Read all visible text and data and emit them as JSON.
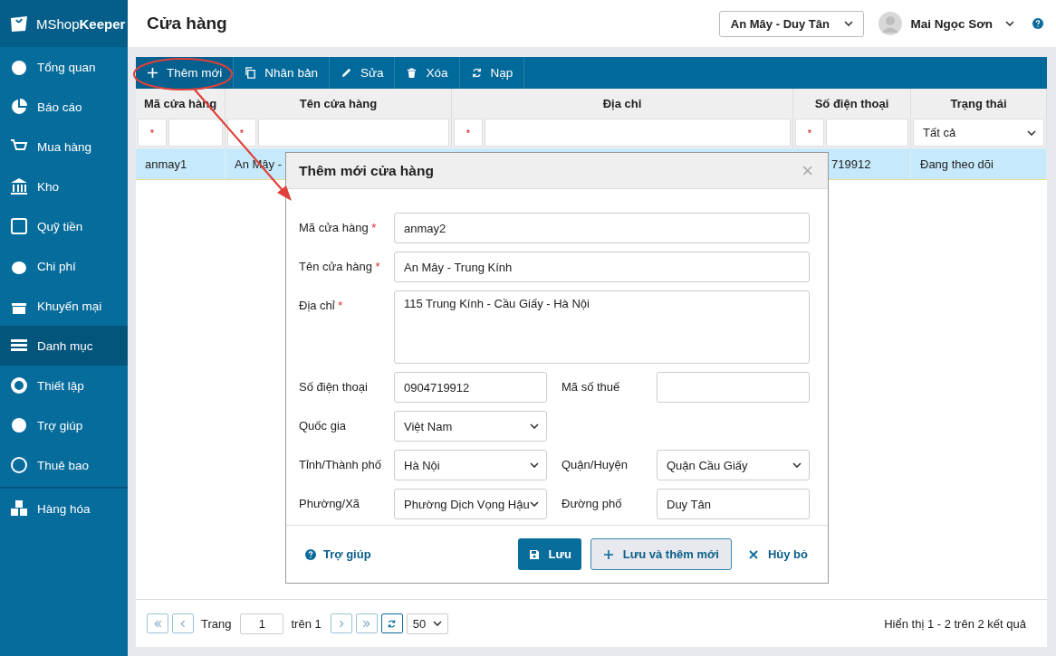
{
  "sidebar": {
    "logo": {
      "regular": "MShop",
      "bold": "Keeper"
    },
    "items": [
      {
        "label": "Tổng quan",
        "selected": false
      },
      {
        "label": "Báo cáo",
        "selected": false
      },
      {
        "label": "Mua hàng",
        "selected": false
      },
      {
        "label": "Kho",
        "selected": false
      },
      {
        "label": "Quỹ tiền",
        "selected": false
      },
      {
        "label": "Chi phí",
        "selected": false
      },
      {
        "label": "Khuyến mại",
        "selected": false
      },
      {
        "label": "Danh mục",
        "selected": true
      },
      {
        "label": "Thiết lập",
        "selected": false
      },
      {
        "label": "Trợ giúp",
        "selected": false
      },
      {
        "label": "Thuê bao",
        "selected": false
      }
    ],
    "bottom_item": {
      "label": "Hàng hóa",
      "selected": false
    }
  },
  "header": {
    "title": "Cửa hàng",
    "store": "An Mây - Duy Tân",
    "user": "Mai Ngọc Sơn"
  },
  "toolbar": [
    {
      "label": "Thêm mới",
      "highlighted": true
    },
    {
      "label": "Nhân bản",
      "highlighted": false
    },
    {
      "label": "Sửa",
      "highlighted": false
    },
    {
      "label": "Xóa",
      "highlighted": false
    },
    {
      "label": "Nạp",
      "highlighted": false
    }
  ],
  "table": {
    "columns": [
      {
        "label": "Mã cửa hàng",
        "filter": {
          "kind": "text",
          "operator": "*"
        }
      },
      {
        "label": "Tên cửa hàng",
        "filter": {
          "kind": "text",
          "operator": "*"
        }
      },
      {
        "label": "Địa chỉ",
        "filter": {
          "kind": "text",
          "operator": "*"
        }
      },
      {
        "label": "Số điện thoại",
        "filter": {
          "kind": "text",
          "operator": "*"
        }
      },
      {
        "label": "Trạng thái",
        "filter": {
          "kind": "select",
          "value": "Tất cả"
        }
      }
    ],
    "rows": [
      {
        "selected": true,
        "cells": [
          "anmay1",
          "An Mây - ",
          "",
          "719912",
          "Đang theo dõi"
        ]
      }
    ]
  },
  "dialog": {
    "title": "Thêm mới cửa hàng",
    "close": "×",
    "rows": [
      [
        {
          "label": "Mã cửa hàng",
          "mark": "*",
          "kind": "input",
          "value": "anmay2"
        }
      ],
      [
        {
          "label": "Tên cửa hàng",
          "mark": "*",
          "kind": "input",
          "value": "An Mây - Trung Kính"
        }
      ],
      [
        {
          "label": "Địa chỉ",
          "mark": "*",
          "kind": "textarea",
          "value": "115 Trung Kính - Cầu Giấy - Hà Nội"
        }
      ],
      [
        {
          "label": "Số điện thoại",
          "kind": "input",
          "value": "0904719912"
        },
        {
          "label": "Mã số thuế",
          "kind": "input"
        }
      ],
      [
        {
          "label": "Quốc gia",
          "kind": "select",
          "value": "Việt Nam"
        }
      ],
      [
        {
          "label": "Tỉnh/Thành phố",
          "kind": "select",
          "value": "Hà Nội"
        },
        {
          "label": "Quận/Huyện",
          "kind": "select",
          "value": "Quận Cầu Giấy"
        }
      ],
      [
        {
          "label": "Phường/Xã",
          "kind": "select",
          "value": "Phường Dịch Vọng Hậu"
        },
        {
          "label": "Đường phố",
          "kind": "input",
          "value": "Duy Tân"
        }
      ]
    ],
    "help": "Trợ giúp",
    "save": "Lưu",
    "save_new": "Lưu và thêm mới",
    "cancel": "Hủy bỏ"
  },
  "pagination": {
    "page_label": "Trang",
    "page": "1",
    "of": "trên 1",
    "page_size": "50",
    "summary": "Hiển thị 1 - 2 trên 2 kết quả"
  }
}
